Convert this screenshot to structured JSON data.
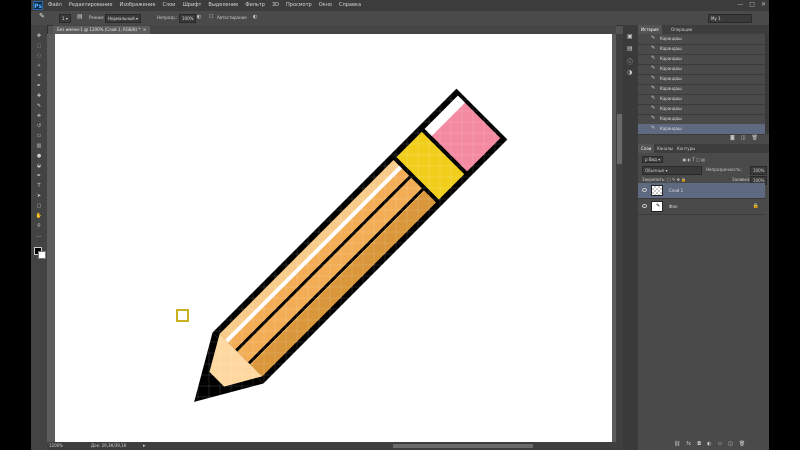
{
  "app": {
    "logo": "Ps"
  },
  "menu": [
    "Файл",
    "Редактирование",
    "Изображение",
    "Слои",
    "Шрифт",
    "Выделение",
    "Фильтр",
    "3D",
    "Просмотр",
    "Окно",
    "Справка"
  ],
  "window_controls": [
    "—",
    "□",
    "✕"
  ],
  "options": {
    "mode_label": "Режим:",
    "mode_value": "Нормальный",
    "opacity_label": "Непрозр.:",
    "opacity_value": "100%",
    "auto_erase_label": "Автостирание",
    "workspace_value": "Мy 1"
  },
  "document": {
    "tab_title": "Без имени-1 @ 1200% (Слой 1, RGB/8) *",
    "zoom": "1200%",
    "doc_info": "Док: 29,3К/39,1К"
  },
  "history": {
    "tabs": [
      "История",
      "Операции"
    ],
    "items": [
      "Карандаш",
      "Карандаш",
      "Карандаш",
      "Карандаш",
      "Карандаш",
      "Карандаш",
      "Карандаш",
      "Карандаш",
      "Карандаш",
      "Карандаш"
    ]
  },
  "layers": {
    "tabs": [
      "Слои",
      "Каналы",
      "Контуры"
    ],
    "kind_label": "Вид",
    "blend": "Обычные",
    "opacity_label": "Непрозрачность:",
    "opacity_value": "100%",
    "lock_label": "Закрепить:",
    "fill_label": "Заливка:",
    "fill_value": "100%",
    "items": [
      {
        "name": "Слой 1",
        "active": true
      },
      {
        "name": "Фон",
        "active": false
      }
    ]
  },
  "pixel_colors": {
    "outline": "#000000",
    "eraser": "#f48aa2",
    "ferrule": "#f1ce1c",
    "body": "#f2ad56",
    "body_shade": "#d9963a",
    "body_highlight": "#f8cb8a",
    "shine": "#ffffff",
    "wood": "#fed8a0",
    "cursor": "#c8b220"
  }
}
